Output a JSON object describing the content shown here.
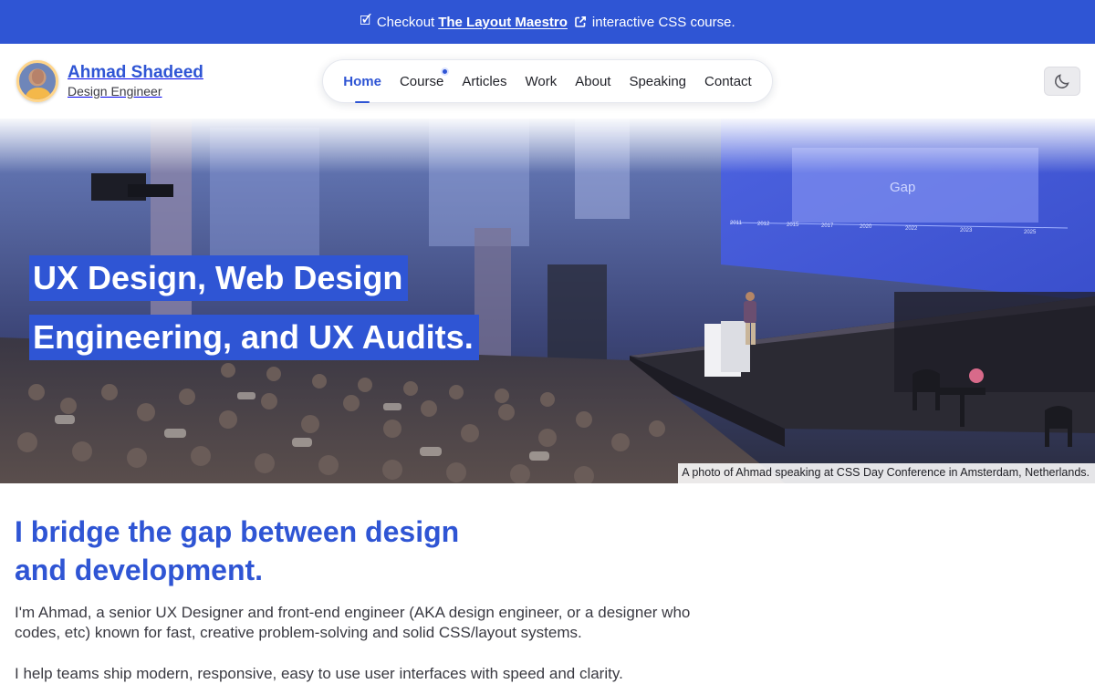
{
  "announcement": {
    "prefix": "Checkout",
    "link_label": "The Layout Maestro",
    "suffix": "interactive CSS course.",
    "emoji": "🗹"
  },
  "brand": {
    "name": "Ahmad Shadeed",
    "role": "Design Engineer"
  },
  "nav": {
    "items": [
      {
        "label": "Home",
        "active": true
      },
      {
        "label": "Course",
        "badge": true
      },
      {
        "label": "Articles"
      },
      {
        "label": "Work"
      },
      {
        "label": "About"
      },
      {
        "label": "Speaking"
      },
      {
        "label": "Contact"
      }
    ]
  },
  "theme_toggle": {
    "icon": "moon-icon"
  },
  "hero": {
    "title_line1": "UX Design, Web Design",
    "title_line2": "Engineering, and UX Audits.",
    "caption": "A photo of Ahmad speaking at CSS Day Conference in Amsterdam, Netherlands.",
    "slide": {
      "heading": "Gap",
      "years": [
        "2011",
        "2012",
        "2015",
        "2017",
        "2020",
        "2022",
        "2023",
        "2025"
      ]
    }
  },
  "content": {
    "headline_line1": "I bridge the gap between design",
    "headline_line2": "and development.",
    "intro": "I'm Ahmad, a senior UX Designer and front-end engineer (AKA design engineer, or a designer who codes, etc) known for fast, creative problem-solving and solid CSS/layout systems.",
    "intro2": "I help teams ship modern, responsive, easy to use user interfaces with speed and clarity."
  },
  "colors": {
    "accent": "#2f55d4",
    "announce_bg": "#2f55d4"
  }
}
